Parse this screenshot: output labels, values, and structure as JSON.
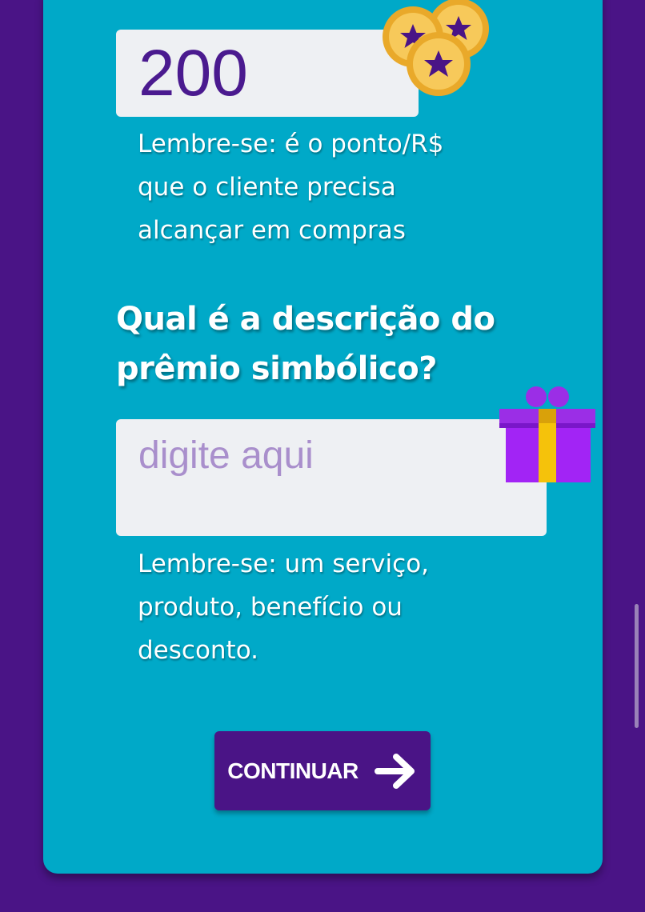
{
  "points": {
    "value": "200",
    "hint": "Lembre-se: é o ponto/R$\nque o cliente precisa\nalcançar em compras"
  },
  "prize": {
    "question": "Qual é a descrição do prêmio simbólico?",
    "placeholder": "digite aqui",
    "hint": "Lembre-se: um serviço,\nproduto, benefício ou\ndesconto."
  },
  "continue_button": {
    "label": "CONTINUAR",
    "icon": "arrow-right-icon"
  },
  "decorations": {
    "coins_icon": "gold-coins-icon",
    "gift_icon": "gift-box-icon"
  },
  "colors": {
    "background": "#4a1486",
    "card": "#00a9c8",
    "input_text": "#4a1a8f",
    "placeholder": "#a98fcc"
  }
}
